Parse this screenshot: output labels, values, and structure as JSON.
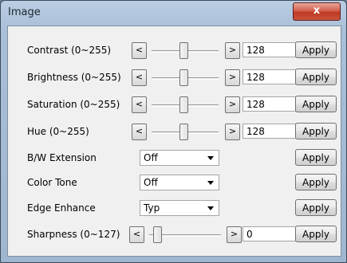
{
  "window": {
    "title": "Image",
    "close_label": "x"
  },
  "sliders": [
    {
      "label": "Contrast (0~255)",
      "value": "128",
      "dec": "<",
      "inc": ">",
      "apply": "Apply"
    },
    {
      "label": "Brightness (0~255)",
      "value": "128",
      "dec": "<",
      "inc": ">",
      "apply": "Apply"
    },
    {
      "label": "Saturation (0~255)",
      "value": "128",
      "dec": "<",
      "inc": ">",
      "apply": "Apply"
    },
    {
      "label": "Hue (0~255)",
      "value": "128",
      "dec": "<",
      "inc": ">",
      "apply": "Apply"
    }
  ],
  "selects": [
    {
      "label": "B/W Extension",
      "value": "Off",
      "apply": "Apply"
    },
    {
      "label": "Color Tone",
      "value": "Off",
      "apply": "Apply"
    },
    {
      "label": "Edge Enhance",
      "value": "Typ",
      "apply": "Apply"
    }
  ],
  "sharpness": {
    "label": "Sharpness (0~127)",
    "value": "0",
    "dec": "<",
    "inc": ">",
    "apply": "Apply"
  }
}
